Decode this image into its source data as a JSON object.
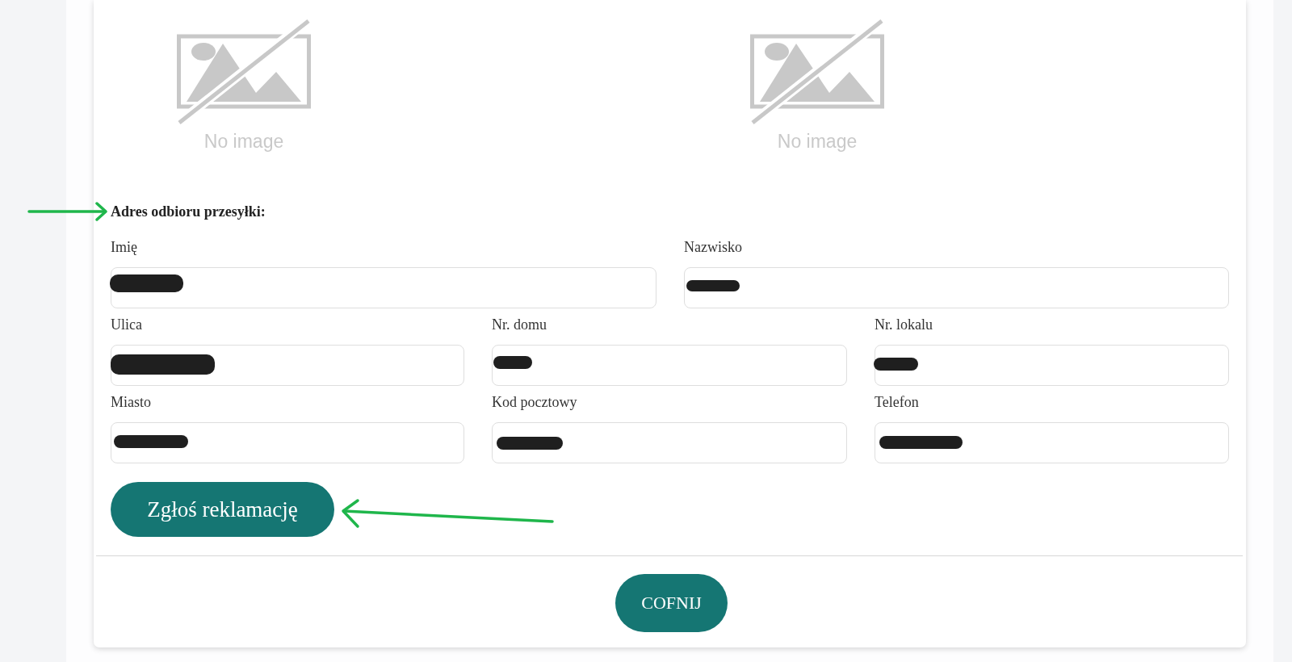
{
  "images": [
    {
      "caption": "No image"
    },
    {
      "caption": "No image"
    }
  ],
  "shipping_address": {
    "heading": "Adres odbioru przesyłki:",
    "rows": [
      {
        "fields": [
          {
            "label": "Imię",
            "redacted": true
          },
          {
            "label": "Nazwisko",
            "redacted": true
          }
        ]
      },
      {
        "fields": [
          {
            "label": "Ulica",
            "redacted": true
          },
          {
            "label": "Nr. domu",
            "redacted": true
          },
          {
            "label": "Nr. lokalu",
            "redacted": true
          }
        ]
      },
      {
        "fields": [
          {
            "label": "Miasto",
            "redacted": true
          },
          {
            "label": "Kod pocztowy",
            "redacted": true
          },
          {
            "label": "Telefon",
            "redacted": true
          }
        ]
      }
    ]
  },
  "submit_button": "Zgłoś reklamację",
  "back_button": "COFNIJ",
  "annotations": [
    {
      "kind": "arrow"
    },
    {
      "kind": "arrow"
    }
  ]
}
